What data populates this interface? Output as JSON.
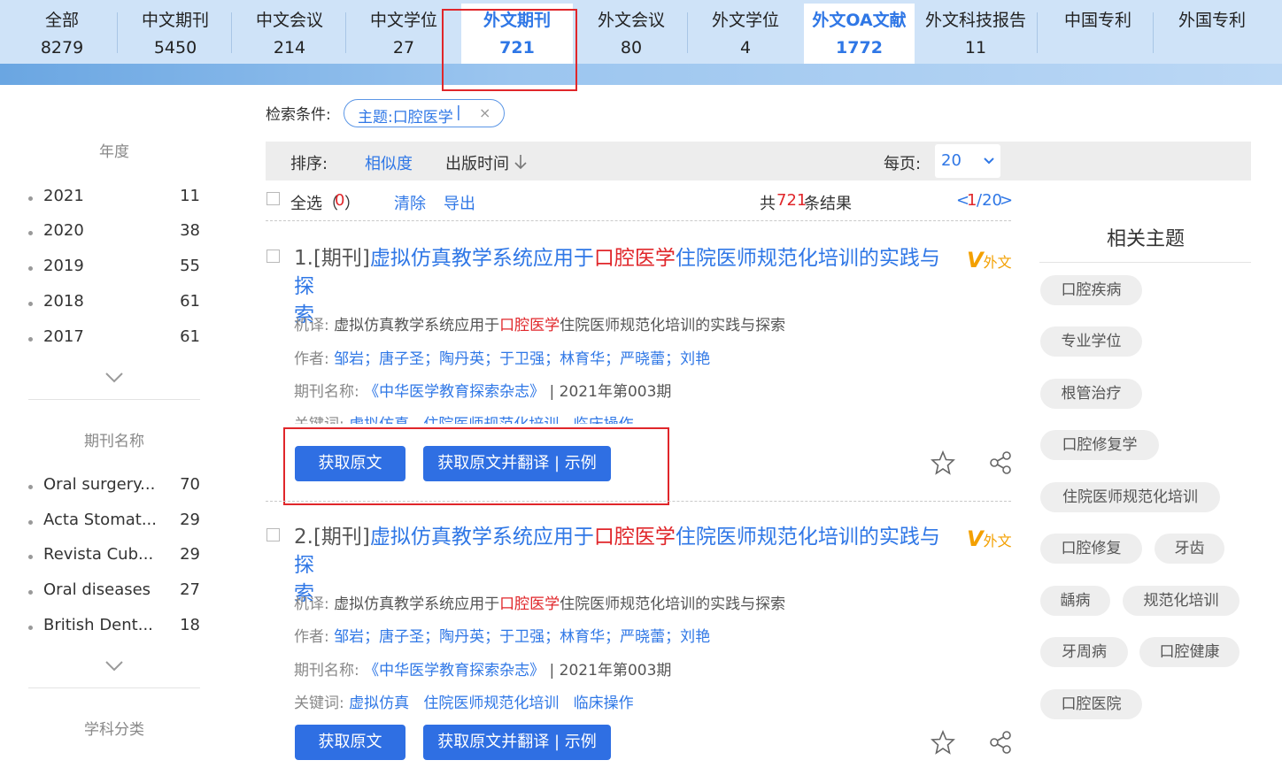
{
  "tabs": [
    {
      "name": "全部",
      "count": "8279"
    },
    {
      "name": "中文期刊",
      "count": "5450"
    },
    {
      "name": "中文会议",
      "count": "214"
    },
    {
      "name": "中文学位",
      "count": "27"
    },
    {
      "name": "外文期刊",
      "count": "721"
    },
    {
      "name": "外文会议",
      "count": "80"
    },
    {
      "name": "外文学位",
      "count": "4"
    },
    {
      "name": "外文OA文献",
      "count": "1772"
    },
    {
      "name": "外文科技报告",
      "count": "11"
    },
    {
      "name": "中国专利",
      "count": ""
    },
    {
      "name": "外国专利",
      "count": ""
    }
  ],
  "active_tabs": [
    "外文期刊",
    "外文OA文献"
  ],
  "sidebar": {
    "year_title": "年度",
    "years": [
      {
        "label": "2021",
        "count": "11"
      },
      {
        "label": "2020",
        "count": "38"
      },
      {
        "label": "2019",
        "count": "55"
      },
      {
        "label": "2018",
        "count": "61"
      },
      {
        "label": "2017",
        "count": "61"
      }
    ],
    "journal_title": "期刊名称",
    "journals": [
      {
        "label": "Oral surgery...",
        "count": "70"
      },
      {
        "label": "Acta Stomat...",
        "count": "29"
      },
      {
        "label": "Revista Cub...",
        "count": "29"
      },
      {
        "label": "Oral diseases",
        "count": "27"
      },
      {
        "label": "British Dent...",
        "count": "18"
      }
    ],
    "subject_title": "学科分类"
  },
  "search": {
    "conditions_label": "检索条件:",
    "chip_text": "主题:口腔医学",
    "chip_sep": "|",
    "chip_close": "×"
  },
  "sort": {
    "label": "排序:",
    "relevance": "相似度",
    "pubtime": "出版时间",
    "perpage_label": "每页:",
    "perpage_value": "20"
  },
  "selection": {
    "select_all": "全选",
    "count_open": "（",
    "selected_count": "0",
    "count_close": "）",
    "clear": "清除",
    "export": "导出",
    "total_prefix": "共",
    "total": "721",
    "total_suffix": "条结果",
    "page_prev": "<",
    "page_current": "1",
    "page_sep": "/20",
    "page_next": ">"
  },
  "results": [
    {
      "num": "1.[期刊]",
      "title_a": "虚拟仿真教学系统应用于",
      "title_hl": "口腔医学",
      "title_b": "住院医师规范化培训的实践与探",
      "title_c": "索",
      "badge_v": "V",
      "badge_text": "外文",
      "mt_label": "机译:",
      "mt_a": "虚拟仿真教学系统应用于",
      "mt_hl": "口腔医学",
      "mt_b": "住院医师规范化培训的实践与探索",
      "author_label": "作者:",
      "authors": "邹岩；唐子圣；陶丹英；于卫强；林育华；严晓蕾；刘艳",
      "journal_label": "期刊名称:",
      "journal": "《中华医学教育探索杂志》",
      "issue": "| 2021年第003期",
      "kw_label": "关键词:",
      "keywords": "虚拟仿真   住院医师规范化培训   临床操作",
      "btn_get": "获取原文",
      "btn_translate": "获取原文并翻译 | 示例"
    },
    {
      "num": "2.[期刊]",
      "title_a": "虚拟仿真教学系统应用于",
      "title_hl": "口腔医学",
      "title_b": "住院医师规范化培训的实践与探",
      "title_c": "索",
      "badge_v": "V",
      "badge_text": "外文",
      "mt_label": "机译:",
      "mt_a": "虚拟仿真教学系统应用于",
      "mt_hl": "口腔医学",
      "mt_b": "住院医师规范化培训的实践与探索",
      "author_label": "作者:",
      "authors": "邹岩；唐子圣；陶丹英；于卫强；林育华；严晓蕾；刘艳",
      "journal_label": "期刊名称:",
      "journal": "《中华医学教育探索杂志》",
      "issue": "| 2021年第003期",
      "kw_label": "关键词:",
      "keywords": "虚拟仿真   住院医师规范化培训   临床操作",
      "btn_get": "获取原文",
      "btn_translate": "获取原文并翻译 | 示例"
    }
  ],
  "related": {
    "title": "相关主题",
    "tags": [
      "口腔疾病",
      "专业学位",
      "根管治疗",
      "口腔修复学",
      "住院医师规范化培训",
      "口腔修复",
      "牙齿",
      "龋病",
      "规范化培训",
      "牙周病",
      "口腔健康",
      "口腔医院"
    ]
  },
  "colors": {
    "accent": "#2f77e6",
    "highlight": "#e0262a",
    "button": "#2f6fe3",
    "annotation": "#e0262a"
  }
}
